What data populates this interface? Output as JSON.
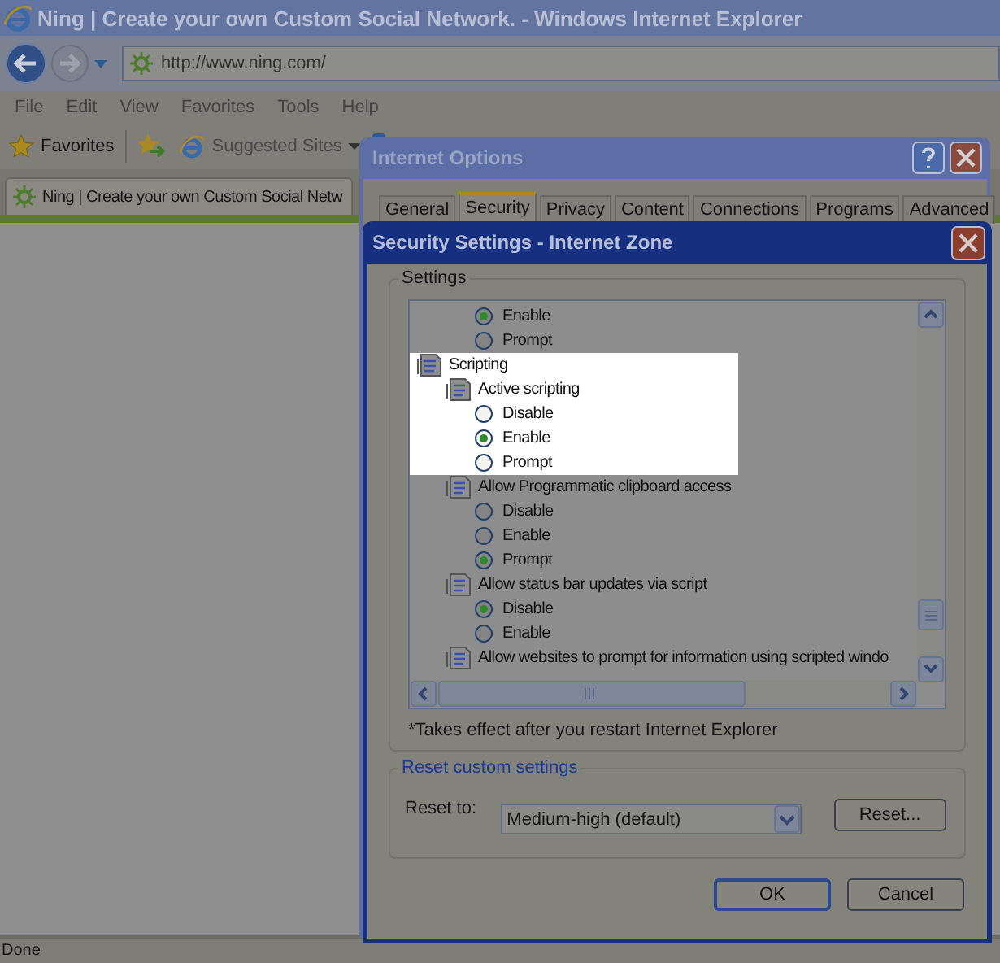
{
  "browser": {
    "title": "Ning | Create your own Custom Social Network. - Windows Internet Explorer",
    "address": "http://www.ning.com/",
    "menu": [
      "File",
      "Edit",
      "View",
      "Favorites",
      "Tools",
      "Help"
    ],
    "favorites_label": "Favorites",
    "suggested_sites": "Suggested Sites",
    "tabs": [
      {
        "label": "Ning | Create your own Custom Social Netw",
        "selected": true
      }
    ],
    "status_bar": "Done"
  },
  "internet_options": {
    "title": "Internet Options",
    "tabs": [
      {
        "label": "General",
        "selected": false
      },
      {
        "label": "Security",
        "selected": true
      },
      {
        "label": "Privacy",
        "selected": false
      },
      {
        "label": "Content",
        "selected": false
      },
      {
        "label": "Connections",
        "selected": false
      },
      {
        "label": "Programs",
        "selected": false
      },
      {
        "label": "Advanced",
        "selected": false
      }
    ]
  },
  "security_settings": {
    "title": "Security Settings - Internet Zone",
    "settings_legend": "Settings",
    "tree": [
      {
        "children": [
          {
            "children": [
              {
                "kind": "option",
                "label": "Enable",
                "selected": true,
                "highlighted": false
              },
              {
                "kind": "option",
                "label": "Prompt",
                "selected": false,
                "highlighted": false
              }
            ]
          }
        ]
      },
      {
        "kind": "category",
        "label": "Scripting",
        "highlighted": true,
        "children": [
          {
            "kind": "setting",
            "label": "Active scripting",
            "highlighted": true,
            "children": [
              {
                "kind": "option",
                "label": "Disable",
                "selected": false,
                "highlighted": true
              },
              {
                "kind": "option",
                "label": "Enable",
                "selected": true,
                "highlighted": true
              },
              {
                "kind": "option",
                "label": "Prompt",
                "selected": false,
                "highlighted": true
              }
            ]
          },
          {
            "kind": "setting",
            "label": "Allow Programmatic clipboard access",
            "highlighted": false,
            "children": [
              {
                "kind": "option",
                "label": "Disable",
                "selected": false,
                "highlighted": false
              },
              {
                "kind": "option",
                "label": "Enable",
                "selected": false,
                "highlighted": false
              },
              {
                "kind": "option",
                "label": "Prompt",
                "selected": true,
                "highlighted": false
              }
            ]
          },
          {
            "kind": "setting",
            "label": "Allow status bar updates via script",
            "highlighted": false,
            "children": [
              {
                "kind": "option",
                "label": "Disable",
                "selected": true,
                "highlighted": false
              },
              {
                "kind": "option",
                "label": "Enable",
                "selected": false,
                "highlighted": false
              }
            ]
          },
          {
            "kind": "setting",
            "label": "Allow websites to prompt for information using scripted windo",
            "highlighted": false
          }
        ]
      }
    ],
    "note": "*Takes effect after you restart Internet Explorer",
    "reset_legend": "Reset custom settings",
    "reset_label": "Reset to:",
    "reset_value": "Medium-high (default)",
    "reset_button": "Reset...",
    "buttons": [
      {
        "label": "OK",
        "default": true
      },
      {
        "label": "Cancel",
        "default": false
      }
    ]
  }
}
